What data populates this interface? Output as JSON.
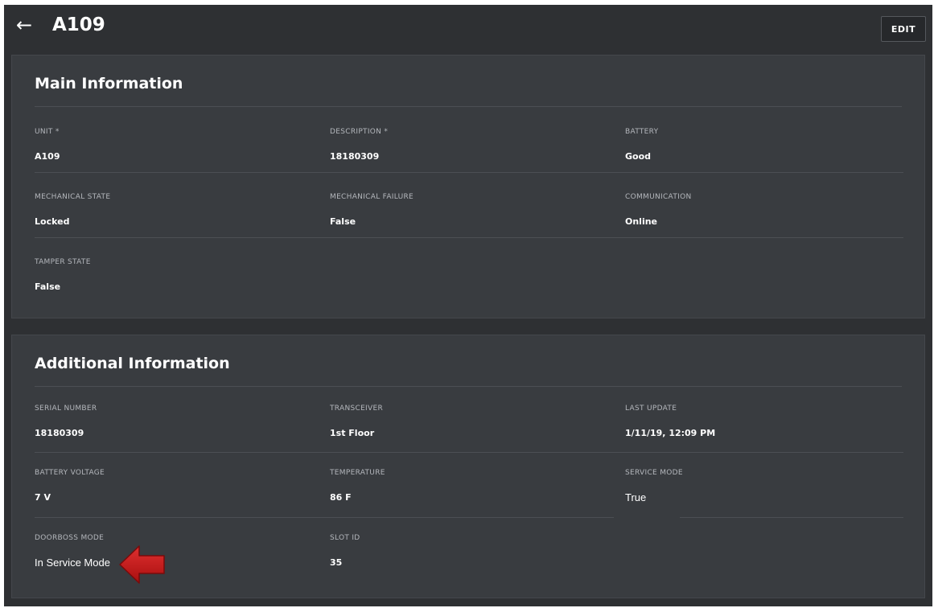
{
  "header": {
    "back_icon": "arrow-left-icon",
    "back_glyph": "←",
    "title": "A109",
    "edit_label": "EDIT"
  },
  "main_info": {
    "title": "Main Information",
    "fields": [
      {
        "label": "UNIT *",
        "value": "A109"
      },
      {
        "label": "DESCRIPTION *",
        "value": "18180309"
      },
      {
        "label": "BATTERY",
        "value": "Good"
      },
      {
        "label": "MECHANICAL STATE",
        "value": "Locked"
      },
      {
        "label": "MECHANICAL FAILURE",
        "value": "False"
      },
      {
        "label": "COMMUNICATION",
        "value": "Online"
      },
      {
        "label": "TAMPER STATE",
        "value": "False"
      }
    ]
  },
  "additional_info": {
    "title": "Additional Information",
    "fields": [
      {
        "label": "SERIAL NUMBER",
        "value": "18180309"
      },
      {
        "label": "TRANSCEIVER",
        "value": "1st Floor"
      },
      {
        "label": "LAST UPDATE",
        "value": "1/11/19, 12:09 PM"
      },
      {
        "label": "BATTERY VOLTAGE",
        "value": "7 V"
      },
      {
        "label": "TEMPERATURE",
        "value": "86 F"
      },
      {
        "label": "SERVICE MODE",
        "value": "True"
      },
      {
        "label": "DOORBOSS MODE",
        "value": "In Service Mode"
      },
      {
        "label": "SLOT ID",
        "value": "35"
      }
    ]
  },
  "annotation": {
    "arrow_icon": "red-arrow-left-icon",
    "arrow_color": "#cc1a1a"
  },
  "colors": {
    "background": "#2e3033",
    "card": "#393c40",
    "label": "#b4b7bc",
    "value": "#ffffff"
  }
}
